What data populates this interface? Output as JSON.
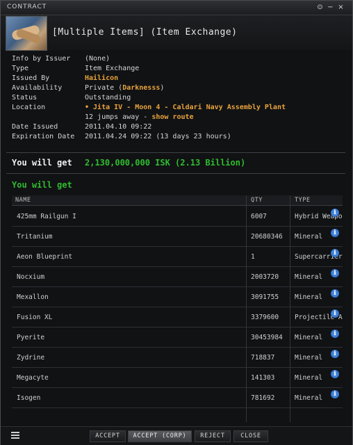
{
  "window": {
    "title": "CONTRACT"
  },
  "header": {
    "title": "[Multiple Items] (Item Exchange)"
  },
  "info": {
    "info_by_issuer": {
      "label": "Info by Issuer",
      "value": "(None)"
    },
    "type": {
      "label": "Type",
      "value": "Item Exchange"
    },
    "issued_by": {
      "label": "Issued By",
      "value": "Hailicon"
    },
    "availability": {
      "label": "Availability",
      "prefix": "Private (",
      "corp": "Darknesss",
      "suffix": ")"
    },
    "status": {
      "label": "Status",
      "value": "Outstanding"
    },
    "location": {
      "label": "Location",
      "value": "• Jita IV - Moon 4 - Caldari Navy Assembly Plant",
      "jumps": "12 jumps away - ",
      "route": "show route"
    },
    "date_issued": {
      "label": "Date Issued",
      "value": "2011.04.10 09:22"
    },
    "expiration": {
      "label": "Expiration Date",
      "value": "2011.04.24 09:22 (13 days 23 hours)"
    }
  },
  "you_will_get_isk": {
    "label": "You will get",
    "value": "2,130,000,000 ISK (2.13 Billion)"
  },
  "you_will_get_items": {
    "label": "You will get"
  },
  "table": {
    "headers": {
      "name": "NAME",
      "qty": "QTY",
      "type": "TYPE"
    },
    "rows": [
      {
        "name": "425mm Railgun I",
        "qty": "6007",
        "type": "Hybrid Weapon"
      },
      {
        "name": "Tritanium",
        "qty": "20680346",
        "type": "Mineral"
      },
      {
        "name": "Aeon Blueprint",
        "qty": "1",
        "type": "Supercarrier Blueprint"
      },
      {
        "name": "Nocxium",
        "qty": "2003720",
        "type": "Mineral"
      },
      {
        "name": "Mexallon",
        "qty": "3091755",
        "type": "Mineral"
      },
      {
        "name": "Fusion XL",
        "qty": "3379600",
        "type": "Projectile Ammo"
      },
      {
        "name": "Pyerite",
        "qty": "30453984",
        "type": "Mineral"
      },
      {
        "name": "Zydrine",
        "qty": "718837",
        "type": "Mineral"
      },
      {
        "name": "Megacyte",
        "qty": "141303",
        "type": "Mineral"
      },
      {
        "name": "Isogen",
        "qty": "781692",
        "type": "Mineral"
      }
    ]
  },
  "footer": {
    "accept": "ACCEPT",
    "accept_corp": "ACCEPT (CORP)",
    "reject": "REJECT",
    "close": "CLOSE"
  },
  "colors": {
    "accent_orange": "#e8a33c",
    "get_green": "#2fbd2f",
    "info_blue": "#1f5fc0"
  }
}
